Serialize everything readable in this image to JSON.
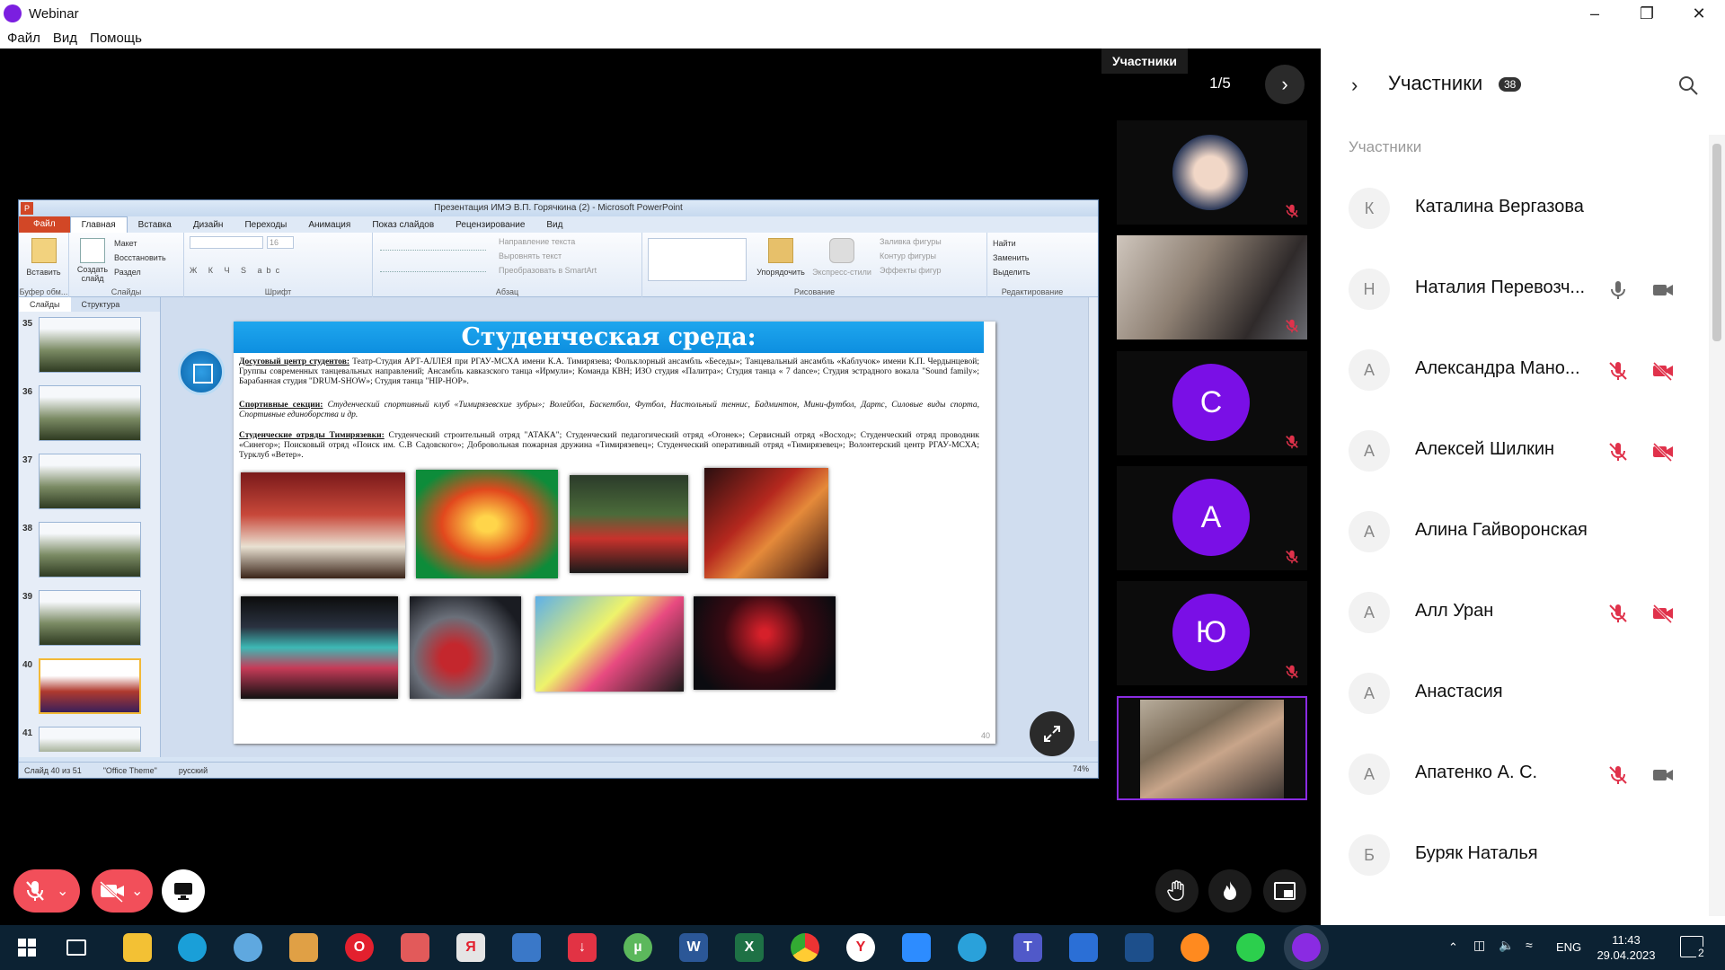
{
  "window": {
    "title": "Webinar"
  },
  "menu": [
    "Файл",
    "Вид",
    "Помощь"
  ],
  "stage": {
    "tooltip": "Участники",
    "pager": "1/5",
    "tiles": [
      {
        "type": "photo"
      },
      {
        "type": "photo"
      },
      {
        "type": "letter",
        "letter": "С"
      },
      {
        "type": "letter",
        "letter": "А"
      },
      {
        "type": "letter",
        "letter": "Ю"
      },
      {
        "type": "photo-active"
      }
    ]
  },
  "ppt": {
    "title": "Презентация ИМЭ В.П. Горячкина (2) - Microsoft PowerPoint",
    "logo": "P",
    "tabs": [
      "Файл",
      "Главная",
      "Вставка",
      "Дизайн",
      "Переходы",
      "Анимация",
      "Показ слайдов",
      "Рецензирование",
      "Вид"
    ],
    "ribbon": {
      "paste": "Вставить",
      "create_slide": "Создать слайд",
      "layout": "Макет",
      "restore": "Восстановить",
      "section": "Раздел",
      "font_size": "16",
      "text_direction": "Направление текста",
      "align_text": "Выровнять текст",
      "smartart": "Преобразовать в SmartArt",
      "arrange": "Упорядочить",
      "quick_styles": "Экспресс-стили",
      "fill": "Заливка фигуры",
      "outline": "Контур фигуры",
      "effects": "Эффекты фигур",
      "find": "Найти",
      "replace": "Заменить",
      "select": "Выделить",
      "groups": [
        "Буфер обм...",
        "Слайды",
        "Шрифт",
        "Абзац",
        "Рисование",
        "Редактирование"
      ]
    },
    "pane_tabs": [
      "Слайды",
      "Структура"
    ],
    "thumbs": [
      "35",
      "36",
      "37",
      "38",
      "39",
      "40",
      "41"
    ],
    "status": {
      "slide": "Слайд 40 из 51",
      "theme": "\"Office Theme\"",
      "lang": "русский",
      "zoom": "74%"
    }
  },
  "slide": {
    "title": "Студенческая среда:",
    "para1_head": "Досуговый центр студентов:",
    "para1_body": " Театр-Студия АРТ-АЛЛЕЯ при РГАУ-МСХА имени К.А. Тимирязева; Фольклорный ансамбль «Беседы»; Танцевальный ансамбль «Каблучок» имени К.П. Чердынцевой; Группы современных танцевальных направлений; Ансамбль кавказского танца «Ирмули»; Команда КВН; ИЗО студия «Палитра»; Студия танца « 7 dance»; Студия эстрадного вокала \"Sound family»; Барабанная студия \"DRUM-SHOW»; Студия танца \"HIP-HOP».",
    "para2_head": "Спортивные секции:",
    "para2_body": " Студенческий спортивный клуб «Тимирязевские зубры»; Волейбол, Баскетбол, Футбол, Настольный теннис, Бадминтон, Мини-футбол, Дартс, Силовые виды спорта, Спортивные единоборства и др.",
    "para3_head": "Студенческие отряды Тимирязевки:",
    "para3_body": " Студенческий строительный отряд \"АТАКА\"; Студенческий педагогический отряд «Огонек»; Сервисный отряд «Восход»; Студенческий отряд проводник «Синегор»; Поисковый отряд «Поиск им. С.В Садовского»; Добровольная пожарная дружина «Тимирязевец»; Студенческий оперативный отряд «Тимирязевец»; Волонтерский центр РГАУ-МСХА; Турклуб «Ветер».",
    "page": "40"
  },
  "panel": {
    "title": "Участники",
    "count": "38",
    "section": "Участники",
    "participants": [
      {
        "initial": "К",
        "name": "Каталина Вергазова",
        "mic": "none",
        "cam": "none"
      },
      {
        "initial": "Н",
        "name": "Наталия Перевозч...",
        "mic": "on",
        "cam": "on"
      },
      {
        "initial": "А",
        "name": "Александра Мано...",
        "mic": "off",
        "cam": "off"
      },
      {
        "initial": "А",
        "name": "Алексей Шилкин",
        "mic": "off",
        "cam": "off"
      },
      {
        "initial": "А",
        "name": "Алина Гайворонская",
        "mic": "none",
        "cam": "none"
      },
      {
        "initial": "А",
        "name": "Алл Уран",
        "mic": "off",
        "cam": "off"
      },
      {
        "initial": "А",
        "name": "Анастасия",
        "mic": "none",
        "cam": "none"
      },
      {
        "initial": "А",
        "name": "Апатенко А. С.",
        "mic": "off",
        "cam": "on"
      },
      {
        "initial": "Б",
        "name": "Буряк Наталья",
        "mic": "none",
        "cam": "none"
      }
    ]
  },
  "taskbar": {
    "lang": "ENG",
    "time": "11:43",
    "date": "29.04.2023",
    "notif_count": "2"
  },
  "colors": {
    "accent": "#7a0fe6",
    "danger": "#f24f5a",
    "taskbar": "#0c2233"
  }
}
